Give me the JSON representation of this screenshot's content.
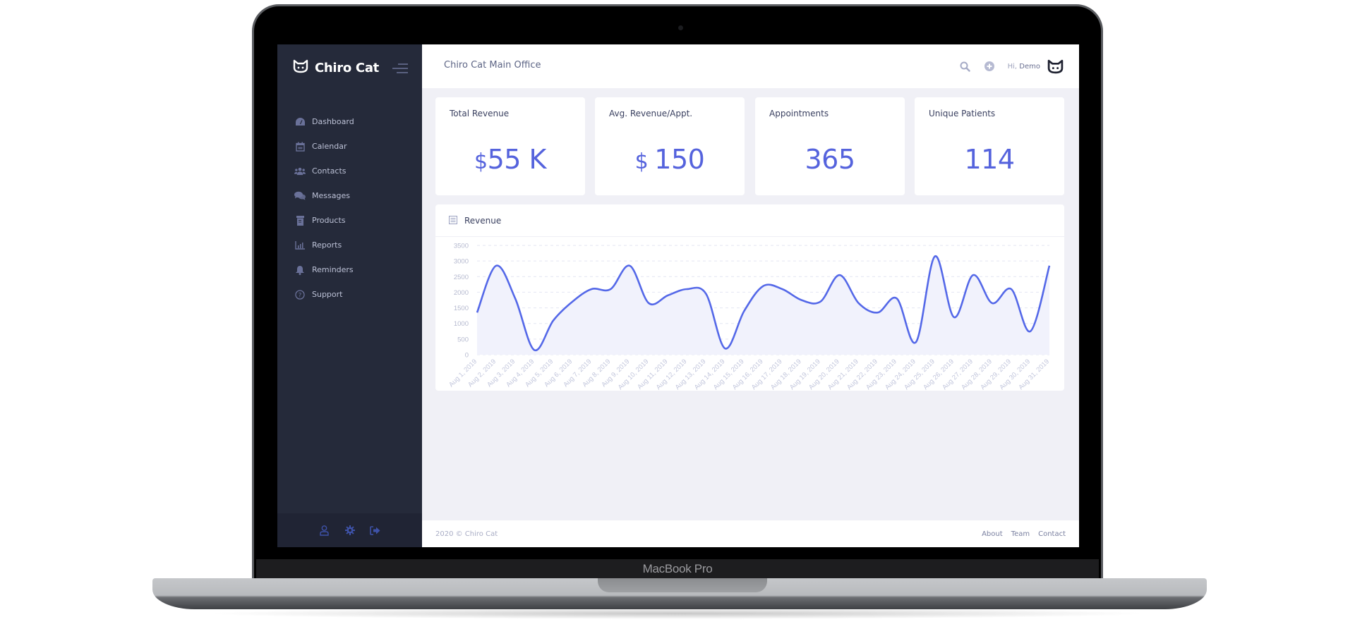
{
  "device": {
    "label": "MacBook Pro"
  },
  "brand": {
    "name": "Chiro Cat"
  },
  "sidebar": {
    "items": [
      {
        "label": "Dashboard",
        "icon": "dashboard-icon"
      },
      {
        "label": "Calendar",
        "icon": "calendar-icon"
      },
      {
        "label": "Contacts",
        "icon": "contacts-icon"
      },
      {
        "label": "Messages",
        "icon": "messages-icon"
      },
      {
        "label": "Products",
        "icon": "products-icon"
      },
      {
        "label": "Reports",
        "icon": "reports-icon"
      },
      {
        "label": "Reminders",
        "icon": "bell-icon"
      },
      {
        "label": "Support",
        "icon": "help-icon"
      }
    ],
    "footer_icons": [
      "user-icon",
      "gear-icon",
      "logout-icon"
    ]
  },
  "header": {
    "office": "Chiro Cat Main Office",
    "greeting_prefix": "Hi,",
    "user_name": "Demo"
  },
  "stats": [
    {
      "label": "Total Revenue",
      "currency": "$",
      "value": "55 K"
    },
    {
      "label": "Avg. Revenue/Appt.",
      "currency": "$ ",
      "value": "150"
    },
    {
      "label": "Appointments",
      "currency": "",
      "value": "365"
    },
    {
      "label": "Unique Patients",
      "currency": "",
      "value": "114"
    }
  ],
  "revenue_card": {
    "title": "Revenue"
  },
  "colors": {
    "accent": "#5563dd",
    "line": "#5468e8",
    "area": "#f1f2fc",
    "sidebar": "#252a3a"
  },
  "chart_data": {
    "type": "area",
    "title": "Revenue",
    "xlabel": "",
    "ylabel": "",
    "ylim": [
      0,
      3500
    ],
    "yticks": [
      0,
      500,
      1000,
      1500,
      2000,
      2500,
      3000,
      3500
    ],
    "grid": true,
    "categories": [
      "Aug 1, 2019",
      "Aug 2, 2019",
      "Aug 3, 2019",
      "Aug 4, 2019",
      "Aug 5, 2019",
      "Aug 6, 2019",
      "Aug 7, 2019",
      "Aug 8, 2019",
      "Aug 9, 2019",
      "Aug 10, 2019",
      "Aug 11, 2019",
      "Aug 12, 2019",
      "Aug 13, 2019",
      "Aug 14, 2019",
      "Aug 15, 2019",
      "Aug 16, 2019",
      "Aug 17, 2019",
      "Aug 18, 2019",
      "Aug 19, 2019",
      "Aug 20, 2019",
      "Aug 21, 2019",
      "Aug 22, 2019",
      "Aug 23, 2019",
      "Aug 24, 2019",
      "Aug 25, 2019",
      "Aug 26, 2019",
      "Aug 27, 2019",
      "Aug 28, 2019",
      "Aug 29, 2019",
      "Aug 30, 2019",
      "Aug 31, 2019"
    ],
    "series": [
      {
        "name": "Revenue",
        "values": [
          1350,
          2850,
          1800,
          150,
          1100,
          1700,
          2100,
          2100,
          2850,
          1650,
          1900,
          2100,
          1950,
          200,
          1400,
          2200,
          2100,
          1750,
          1700,
          2550,
          1650,
          1350,
          1800,
          400,
          3150,
          1200,
          2550,
          1650,
          2100,
          750,
          2850
        ]
      }
    ]
  },
  "footer": {
    "copyright": "2020 © Chiro Cat",
    "links": [
      "About",
      "Team",
      "Contact"
    ]
  }
}
